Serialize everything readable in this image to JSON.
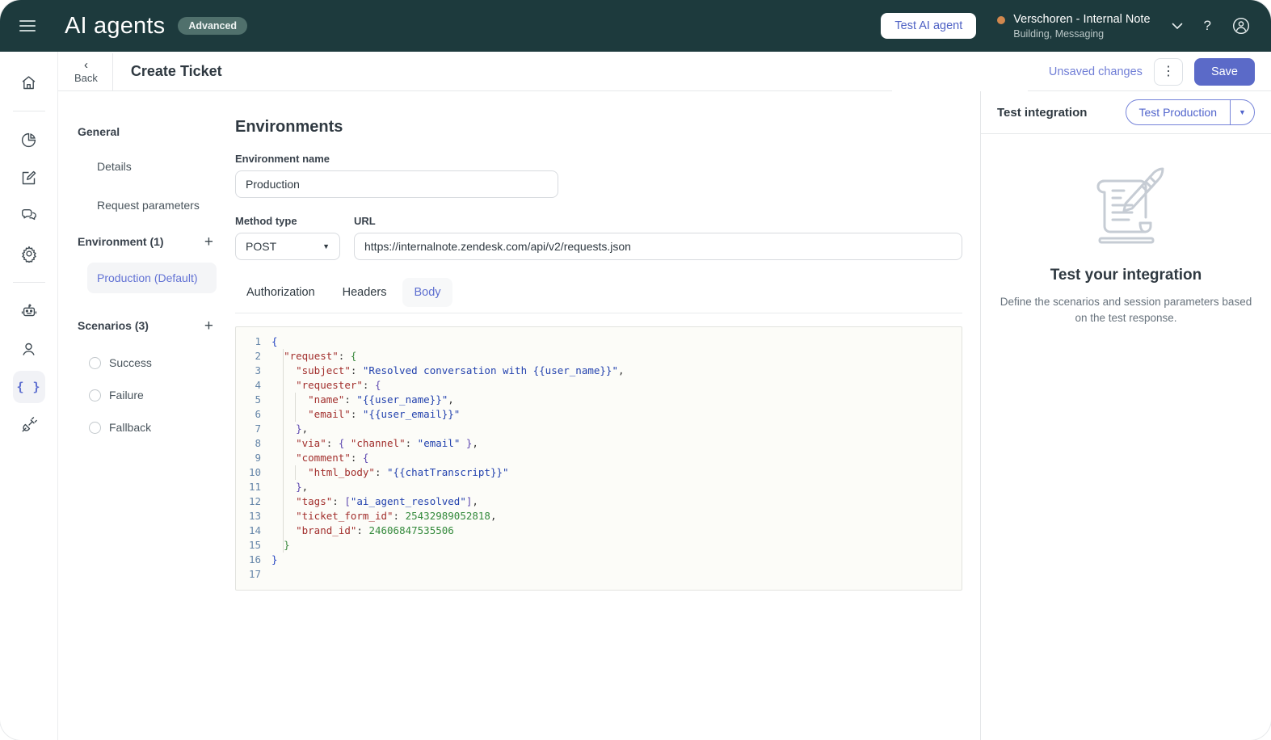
{
  "topbar": {
    "app_title": "AI agents",
    "badge": "Advanced",
    "test_ai_agent_label": "Test AI agent",
    "account_name": "Verschoren - Internal Note",
    "account_sub": "Building, Messaging"
  },
  "subheader": {
    "back_label": "Back",
    "title": "Create Ticket",
    "unsaved_label": "Unsaved changes",
    "save_label": "Save"
  },
  "nav": {
    "general_header": "General",
    "details": "Details",
    "request_parameters": "Request parameters",
    "environment_header": "Environment (1)",
    "environment_selected": "Production (Default)",
    "scenarios_header": "Scenarios (3)",
    "scenarios": [
      "Success",
      "Failure",
      "Fallback"
    ]
  },
  "form": {
    "heading": "Environments",
    "env_name_label": "Environment name",
    "env_name_value": "Production",
    "method_label": "Method type",
    "method_value": "POST",
    "url_label": "URL",
    "url_value": "https://internalnote.zendesk.com/api/v2/requests.json",
    "tabs": {
      "authorization": "Authorization",
      "headers": "Headers",
      "body": "Body"
    },
    "active_tab": "Body"
  },
  "editor": {
    "language": "json",
    "lines": [
      {
        "n": 1,
        "segs": [
          [
            "{",
            "b0"
          ]
        ]
      },
      {
        "n": 2,
        "segs": [
          [
            "  ",
            "pl"
          ],
          [
            "\"request\"",
            "key"
          ],
          [
            ":",
            "pun"
          ],
          [
            " ",
            "pl"
          ],
          [
            "{",
            "b1"
          ]
        ]
      },
      {
        "n": 3,
        "segs": [
          [
            "    ",
            "pl"
          ],
          [
            "\"subject\"",
            "key"
          ],
          [
            ":",
            "pun"
          ],
          [
            " ",
            "pl"
          ],
          [
            "\"Resolved conversation with {{user_name}}\"",
            "str"
          ],
          [
            ",",
            "pun"
          ]
        ]
      },
      {
        "n": 4,
        "segs": [
          [
            "    ",
            "pl"
          ],
          [
            "\"requester\"",
            "key"
          ],
          [
            ":",
            "pun"
          ],
          [
            " ",
            "pl"
          ],
          [
            "{",
            "b2"
          ]
        ]
      },
      {
        "n": 5,
        "segs": [
          [
            "      ",
            "pl"
          ],
          [
            "\"name\"",
            "key"
          ],
          [
            ":",
            "pun"
          ],
          [
            " ",
            "pl"
          ],
          [
            "\"{{user_name}}\"",
            "str"
          ],
          [
            ",",
            "pun"
          ]
        ]
      },
      {
        "n": 6,
        "segs": [
          [
            "      ",
            "pl"
          ],
          [
            "\"email\"",
            "key"
          ],
          [
            ":",
            "pun"
          ],
          [
            " ",
            "pl"
          ],
          [
            "\"{{user_email}}\"",
            "str"
          ]
        ]
      },
      {
        "n": 7,
        "segs": [
          [
            "    ",
            "pl"
          ],
          [
            "}",
            "b2"
          ],
          [
            ",",
            "pun"
          ]
        ]
      },
      {
        "n": 8,
        "segs": [
          [
            "    ",
            "pl"
          ],
          [
            "\"via\"",
            "key"
          ],
          [
            ":",
            "pun"
          ],
          [
            " ",
            "pl"
          ],
          [
            "{",
            "b2"
          ],
          [
            " ",
            "pl"
          ],
          [
            "\"channel\"",
            "key"
          ],
          [
            ":",
            "pun"
          ],
          [
            " ",
            "pl"
          ],
          [
            "\"email\"",
            "str"
          ],
          [
            " ",
            "pl"
          ],
          [
            "}",
            "b2"
          ],
          [
            ",",
            "pun"
          ]
        ]
      },
      {
        "n": 9,
        "segs": [
          [
            "    ",
            "pl"
          ],
          [
            "\"comment\"",
            "key"
          ],
          [
            ":",
            "pun"
          ],
          [
            " ",
            "pl"
          ],
          [
            "{",
            "b2"
          ]
        ]
      },
      {
        "n": 10,
        "segs": [
          [
            "      ",
            "pl"
          ],
          [
            "\"html_body\"",
            "key"
          ],
          [
            ":",
            "pun"
          ],
          [
            " ",
            "pl"
          ],
          [
            "\"{{chatTranscript}}\"",
            "str"
          ]
        ]
      },
      {
        "n": 11,
        "segs": [
          [
            "    ",
            "pl"
          ],
          [
            "}",
            "b2"
          ],
          [
            ",",
            "pun"
          ]
        ]
      },
      {
        "n": 12,
        "segs": [
          [
            "    ",
            "pl"
          ],
          [
            "\"tags\"",
            "key"
          ],
          [
            ":",
            "pun"
          ],
          [
            " ",
            "pl"
          ],
          [
            "[",
            "b2"
          ],
          [
            "\"ai_agent_resolved\"",
            "str"
          ],
          [
            "]",
            "b2"
          ],
          [
            ",",
            "pun"
          ]
        ]
      },
      {
        "n": 13,
        "segs": [
          [
            "    ",
            "pl"
          ],
          [
            "\"ticket_form_id\"",
            "key"
          ],
          [
            ":",
            "pun"
          ],
          [
            " ",
            "pl"
          ],
          [
            "25432989052818",
            "num"
          ],
          [
            ",",
            "pun"
          ]
        ]
      },
      {
        "n": 14,
        "segs": [
          [
            "    ",
            "pl"
          ],
          [
            "\"brand_id\"",
            "key"
          ],
          [
            ":",
            "pun"
          ],
          [
            " ",
            "pl"
          ],
          [
            "24606847535506",
            "num"
          ]
        ]
      },
      {
        "n": 15,
        "segs": [
          [
            "  ",
            "pl"
          ],
          [
            "}",
            "b1"
          ]
        ]
      },
      {
        "n": 16,
        "segs": [
          [
            "}",
            "b0"
          ]
        ]
      },
      {
        "n": 17,
        "segs": []
      }
    ]
  },
  "test_panel": {
    "title": "Test integration",
    "button_label": "Test Production",
    "empty_title": "Test your integration",
    "empty_desc": "Define the scenarios and session parameters based on the test response."
  },
  "colors": {
    "topbar_bg": "#1d3a3d",
    "accent_indigo": "#5b6ac8",
    "account_dot": "#d2884e",
    "code_key": "#a22f2d",
    "code_string": "#2342ae",
    "code_number": "#348a3c"
  }
}
